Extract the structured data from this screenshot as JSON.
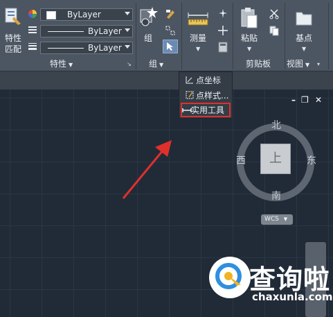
{
  "ribbon": {
    "properties_panel": {
      "match_label_line1": "特性",
      "match_label_line2": "匹配",
      "color_combo": "ByLayer",
      "linetype_combo": "ByLayer",
      "lineweight_combo": "ByLayer",
      "title": "特性"
    },
    "group_panel": {
      "group_label": "组",
      "title": "组"
    },
    "utilities_panel": {
      "measure_label": "测量"
    },
    "clipboard_panel": {
      "paste_label": "粘贴",
      "title": "剪贴板"
    },
    "view_panel": {
      "base_label": "基点",
      "title": "视图"
    }
  },
  "dropdown_menu": {
    "items": [
      {
        "label": "点坐标"
      },
      {
        "label": "点样式..."
      },
      {
        "label": "实用工具"
      }
    ],
    "highlighted_index": 2
  },
  "viewcube": {
    "north": "北",
    "south": "南",
    "east": "东",
    "west": "西",
    "face": "上",
    "wcs_label": "WCS"
  },
  "window_controls": {
    "minimize": "–",
    "restore": "❐",
    "close": "✕"
  },
  "watermark": {
    "brand_cn": "查询啦",
    "brand_url": "chaxunla.com"
  },
  "colors": {
    "highlight": "#e0302c",
    "arrow": "#e0302c",
    "selected_button": "#6b8bb3"
  }
}
